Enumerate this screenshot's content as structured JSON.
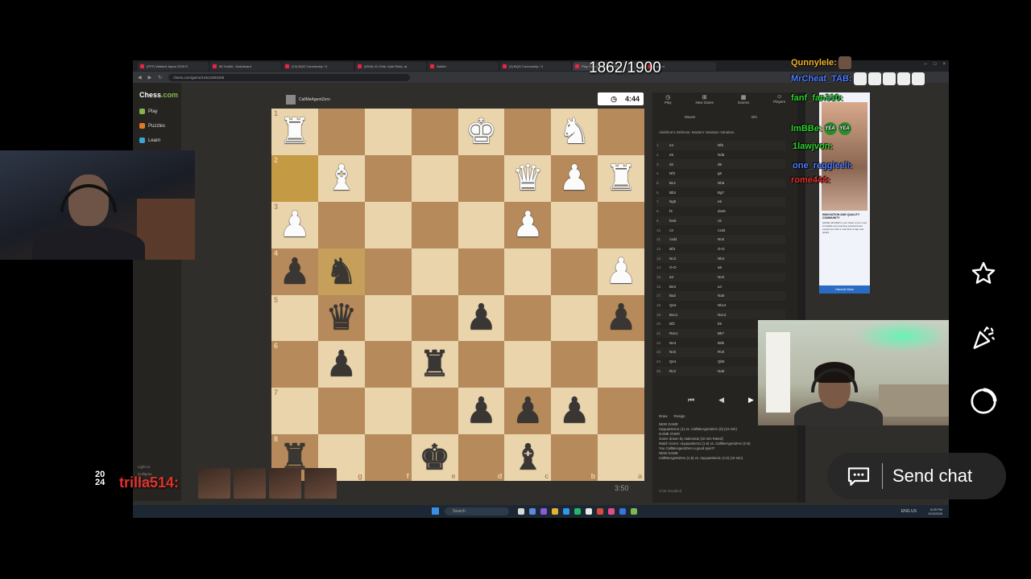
{
  "stream": {
    "rating_counter": "1862/1900"
  },
  "browser": {
    "tabs": [
      "(PFF) Waldorf Japan 2025 R",
      "66 Toolkit - Dashboard",
      "(13) BQG Community / X",
      "(8318) 41 (Tete, Kyle Rich), ar",
      "Switch",
      "(9) BQG Community / X",
      "Play Chess Online for FREE",
      "Gemini"
    ],
    "url": "chess.com/game/14612383406",
    "window_controls": [
      "–",
      "□",
      "×"
    ]
  },
  "chesscom": {
    "logo_text": "Chess",
    "logo_suffix": ".com",
    "nav": [
      {
        "label": "Play",
        "color": "#81b64c"
      },
      {
        "label": "Puzzles",
        "color": "#e07a2b"
      },
      {
        "label": "Learn",
        "color": "#3aa5d8"
      }
    ],
    "sidebar_bottom": [
      "Light UI",
      "Collapse",
      "Settings"
    ],
    "opponent_name": "CallMeAgentZero",
    "opponent_flag": "US",
    "clock_top": "4:44",
    "clock_bottom": "3:50",
    "tabs": [
      {
        "icon": "◷",
        "label": "Play"
      },
      {
        "icon": "⊞",
        "label": "New Game"
      },
      {
        "icon": "▦",
        "label": "Games"
      },
      {
        "icon": "☺",
        "label": "Players"
      }
    ],
    "subtabs": [
      "Moves",
      "Info"
    ],
    "opening": "Alekhine's Defense: Modern Variation Variation",
    "moves": [
      {
        "n": "1.",
        "w": "e4",
        "b": "Nf6"
      },
      {
        "n": "2.",
        "w": "e5",
        "b": "Nd5"
      },
      {
        "n": "3.",
        "w": "d4",
        "b": "d6"
      },
      {
        "n": "4.",
        "w": "Nf3",
        "b": "g6"
      },
      {
        "n": "5.",
        "w": "Bc4",
        "b": "Nb6"
      },
      {
        "n": "6.",
        "w": "Bb3",
        "b": "Bg7"
      },
      {
        "n": "7.",
        "w": "Ng5",
        "b": "e6"
      },
      {
        "n": "8.",
        "w": "f4",
        "b": "dxe5"
      },
      {
        "n": "9.",
        "w": "fxe5",
        "b": "c5"
      },
      {
        "n": "10.",
        "w": "c3",
        "b": "cxd4"
      },
      {
        "n": "11.",
        "w": "cxd4",
        "b": "Nc6"
      },
      {
        "n": "12.",
        "w": "Nf3",
        "b": "O-O"
      },
      {
        "n": "13.",
        "w": "Nc3",
        "b": "Nb4"
      },
      {
        "n": "14.",
        "w": "O-O",
        "b": "a5"
      },
      {
        "n": "15.",
        "w": "a3",
        "b": "Nc6"
      },
      {
        "n": "16.",
        "w": "Be3",
        "b": "a4"
      },
      {
        "n": "17.",
        "w": "Ba2",
        "b": "Na5"
      },
      {
        "n": "18.",
        "w": "Qe2",
        "b": "Nbc4"
      },
      {
        "n": "19.",
        "w": "Bxc4",
        "b": "Nxc4"
      },
      {
        "n": "20.",
        "w": "Bf2",
        "b": "b5"
      },
      {
        "n": "21.",
        "w": "Rac1",
        "b": "Bb7"
      },
      {
        "n": "22.",
        "w": "Ne4",
        "b": "Bd5"
      },
      {
        "n": "23.",
        "w": "Nc5",
        "b": "Rc8"
      },
      {
        "n": "24.",
        "w": "Qe1",
        "b": "Qb6"
      },
      {
        "n": "25.",
        "w": "Rc2",
        "b": "Na5"
      }
    ],
    "nav_buttons": [
      "⏮",
      "◀",
      "▶"
    ],
    "draw_label": "Draw",
    "resign_label": "Resign",
    "game_log": [
      "NEW GAME",
      "rayquanlee11 (1) vs. CallMeAgentZero (0) (10 min)",
      "GAME OVER",
      "Game drawn by stalemate (10 min Rated)",
      "Match Score: rayquanlee11 (1.5) vs. CallMeAgentZero (0.5)",
      "You CallMeAgentZero a good sport?",
      "NEW GAME",
      "CallMeAgentZero (1.5) vs. rayquanlee11 (1.5) (10 min)"
    ],
    "chat_placeholder": "Chat Disabled"
  },
  "board": {
    "rows": [
      [
        "wR",
        "",
        "",
        "",
        "wK",
        "",
        "wN",
        ""
      ],
      [
        "",
        "wB",
        "",
        "",
        "",
        "wQ",
        "wP",
        "wR"
      ],
      [
        "wP",
        "",
        "",
        "",
        "",
        "wP",
        "",
        ""
      ],
      [
        "bP",
        "bN",
        "",
        "",
        "",
        "",
        "",
        "wP"
      ],
      [
        "",
        "bQ",
        "",
        "",
        "bP",
        "",
        "",
        "bP"
      ],
      [
        "",
        "bP",
        "",
        "bR",
        "",
        "",
        "",
        ""
      ],
      [
        "",
        "",
        "",
        "",
        "bP",
        "bP",
        "bP",
        ""
      ],
      [
        "bR",
        "",
        "",
        "bK",
        "",
        "bB",
        "",
        ""
      ]
    ],
    "rank_labels": [
      "1",
      "2",
      "3",
      "4",
      "5",
      "6",
      "7",
      "8"
    ],
    "file_labels": [
      "h",
      "g",
      "f",
      "e",
      "d",
      "c",
      "b",
      "a"
    ],
    "highlighted": [
      [
        1,
        0
      ],
      [
        3,
        1
      ]
    ]
  },
  "ad": {
    "brand": "ebay ads",
    "headline": "INNOVATION AND QUALITY COMMUNITY",
    "body": "SHINE ADVIEW is your ticket to the most incredible and stunning entertainment experience with a new kind of app and award.",
    "cta": "Discover More"
  },
  "taskbar": {
    "search": "Search",
    "clock_time": "8:25 PM",
    "clock_date": "1/24/2026",
    "tray": "ENG  US"
  },
  "overlay_chat": [
    {
      "name": "Qunnylele:",
      "color": "#f0b429",
      "emotes": 1
    },
    {
      "name": "MrCheat_TAB:",
      "color": "#4f7bff",
      "emotes": 5
    },
    {
      "name": "fanf_fan310:",
      "color": "#2bd12b",
      "emotes": 0
    },
    {
      "name": "ImBBe:",
      "color": "#2bd12b",
      "emotes": 2
    },
    {
      "name": "1lawjvon:",
      "color": "#2bd12b",
      "emotes": 0
    },
    {
      "name": "one_reggieeli:",
      "color": "#4f7bff",
      "emotes": 0
    },
    {
      "name": "rome444:",
      "color": "#e3322b",
      "emotes": 0
    }
  ],
  "overlay_emote_text": "YEA",
  "bottom_chat": {
    "badge_top": "20",
    "badge_bottom": "24",
    "name": "trilla514:"
  },
  "youtube": {
    "send_chat": "Send chat"
  }
}
